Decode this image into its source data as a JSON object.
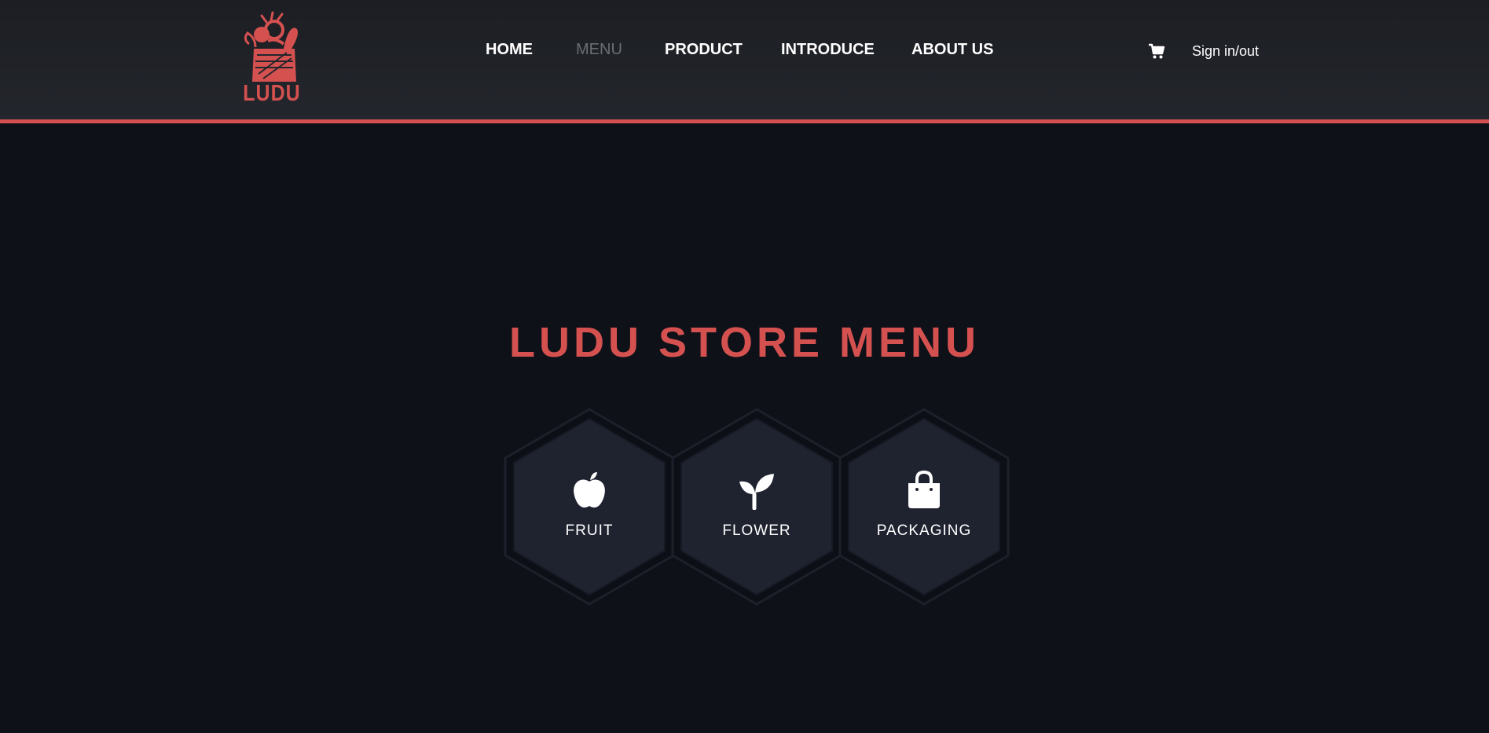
{
  "header": {
    "logo_text": "LUDU",
    "nav": [
      {
        "label": "HOME",
        "active": false
      },
      {
        "label": "MENU",
        "active": true
      },
      {
        "label": "PRODUCT",
        "active": false
      },
      {
        "label": "INTRODUCE",
        "active": false
      },
      {
        "label": "ABOUT US",
        "active": false
      }
    ],
    "cart_icon": "cart-icon",
    "signin_label": "Sign in/out"
  },
  "main": {
    "title": "LUDU STORE MENU",
    "categories": [
      {
        "label": "FRUIT",
        "icon": "apple-icon"
      },
      {
        "label": "FLOWER",
        "icon": "sprout-icon"
      },
      {
        "label": "PACKAGING",
        "icon": "shopping-bag-icon"
      }
    ]
  },
  "colors": {
    "accent": "#d45150",
    "header_bg": "#212328",
    "page_bg": "#0f1119",
    "hex_fill": "#1f2330",
    "nav_active": "#6b6e75"
  }
}
